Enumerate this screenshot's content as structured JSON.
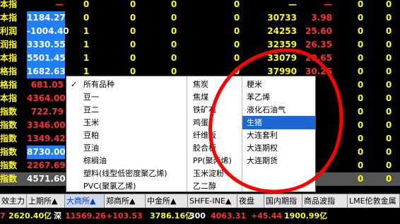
{
  "rows": [
    {
      "name": "本指",
      "price": "—",
      "c1": "0",
      "c2": "0",
      "c3": "0",
      "c4": "0",
      "vol": "—",
      "chg": "—",
      "c7": "0",
      "c8": "0",
      "hl": false,
      "pcolor": "#ff3030"
    },
    {
      "name": "本指",
      "price": "1184.27",
      "c1": "0",
      "c2": "0",
      "c3": "0",
      "c4": "0",
      "vol": "30733",
      "chg": "3.98",
      "c7": "0",
      "c8": "0",
      "hl": true,
      "pcolor": "#ffffff"
    },
    {
      "name": "利润",
      "price": "-1004.40",
      "c1": "1",
      "c2": "0",
      "c3": "0",
      "c4": "0",
      "vol": "24253",
      "chg": "25.60",
      "c7": "0",
      "c8": "0",
      "hl": true,
      "pcolor": "#ffffff"
    },
    {
      "name": "润指",
      "price": "3330.55",
      "c1": "1",
      "c2": "0",
      "c3": "0",
      "c4": "0",
      "vol": "32359",
      "chg": "26.35",
      "c7": "0",
      "c8": "0",
      "hl": true,
      "pcolor": "#ffffff"
    },
    {
      "name": "本指",
      "price": "5501.45",
      "c1": "1",
      "c2": "0",
      "c3": "0",
      "c4": "0",
      "vol": "33079",
      "chg": "29.65",
      "c7": "0",
      "c8": "0",
      "hl": true,
      "pcolor": "#ffffff"
    },
    {
      "name": "格指",
      "price": "1682.63",
      "c1": "1",
      "c2": "0",
      "c3": "0",
      "c4": "0",
      "vol": "37990",
      "chg": "30.26",
      "c7": "0",
      "c8": "0",
      "hl": true,
      "pcolor": "#ffffff"
    },
    {
      "name": "格指",
      "price": "681.05",
      "c1": "",
      "c2": "",
      "c3": "",
      "c4": "",
      "vol": "",
      "chg": "",
      "c7": "0",
      "c8": "0",
      "hl": false,
      "pcolor": "#ff3030"
    },
    {
      "name": "本指",
      "price": "4364.00",
      "c1": "",
      "c2": "",
      "c3": "",
      "c4": "",
      "vol": "",
      "chg": "",
      "c7": "0",
      "c8": "0",
      "hl": false,
      "pcolor": "#ff3030"
    },
    {
      "name": "指数",
      "price": "722.79",
      "c1": "",
      "c2": "",
      "c3": "",
      "c4": "",
      "vol": "",
      "chg": "",
      "c7": "0",
      "c8": "0",
      "hl": false,
      "pcolor": "#ff3030"
    },
    {
      "name": "指数",
      "price": "3346.00",
      "c1": "",
      "c2": "",
      "c3": "",
      "c4": "",
      "vol": "",
      "chg": "",
      "c7": "0",
      "c8": "0",
      "hl": false,
      "pcolor": "#ff3030"
    },
    {
      "name": "指数",
      "price": "1349.42",
      "c1": "",
      "c2": "",
      "c3": "",
      "c4": "",
      "vol": "",
      "chg": "",
      "c7": "0",
      "c8": "0",
      "hl": false,
      "pcolor": "#ff3030"
    },
    {
      "name": "指数",
      "price": "8730.00",
      "c1": "",
      "c2": "",
      "c3": "",
      "c4": "",
      "vol": "",
      "chg": "",
      "c7": "0",
      "c8": "0",
      "hl": true,
      "pcolor": "#ffffff"
    },
    {
      "name": "指数",
      "price": "2267.69",
      "c1": "",
      "c2": "",
      "c3": "",
      "c4": "",
      "vol": "",
      "chg": "",
      "c7": "0",
      "c8": "0",
      "hl": false,
      "pcolor": "#ff3030"
    },
    {
      "name": "指数",
      "price": "4571.60",
      "c1": "",
      "c2": "",
      "c3": "",
      "c4": "",
      "vol": "",
      "chg": "",
      "c7": "0",
      "c8": "0",
      "hl": false,
      "pcolor": "#ffffff",
      "sel": true
    }
  ],
  "menu": {
    "col1": [
      {
        "label": "所有品种",
        "checked": true
      },
      {
        "label": "豆一"
      },
      {
        "label": "豆二"
      },
      {
        "label": "玉米"
      },
      {
        "label": "豆粕"
      },
      {
        "label": "豆油"
      },
      {
        "label": "棕榈油"
      },
      {
        "label": "塑料(线型低密度聚乙烯)"
      },
      {
        "label": "PVC(聚氯乙烯)"
      }
    ],
    "col2": [
      {
        "label": "焦炭"
      },
      {
        "label": "焦煤"
      },
      {
        "label": "铁矿石"
      },
      {
        "label": "鸡蛋"
      },
      {
        "label": "纤维板"
      },
      {
        "label": "胶合板"
      },
      {
        "label": "PP(聚丙烯)"
      },
      {
        "label": "玉米淀粉"
      },
      {
        "label": "乙二醇"
      }
    ],
    "col3": [
      {
        "label": "粳米"
      },
      {
        "label": "苯乙烯"
      },
      {
        "label": "液化石油气"
      },
      {
        "label": "生猪",
        "hl": true
      },
      {
        "label": "大连套利"
      },
      {
        "label": "大连期权"
      },
      {
        "label": "大连期货"
      }
    ]
  },
  "tabs": [
    {
      "label": "效主力",
      "active": false
    },
    {
      "label": "上期所▲",
      "active": false
    },
    {
      "label": "大商所▲",
      "active": true
    },
    {
      "label": "郑商所▲",
      "active": false
    },
    {
      "label": "中金所▲",
      "active": false
    },
    {
      "label": "SHFE-INE▲",
      "active": false
    },
    {
      "label": "夜盘",
      "active": false
    },
    {
      "label": "国内期指",
      "active": false
    },
    {
      "label": "商品波指",
      "active": false
    },
    {
      "label": "LME伦敦金属",
      "active": false
    }
  ],
  "status": [
    {
      "text": "7",
      "color": "#ff3030"
    },
    {
      "text": "2620.40亿",
      "color": "#ffff00"
    },
    {
      "text": "深",
      "color": "#ffffff"
    },
    {
      "text": "11569.26",
      "color": "#ff3030"
    },
    {
      "text": "+103.53",
      "color": "#ff3030"
    },
    {
      "text": "3786.16亿",
      "color": "#ffff00"
    },
    {
      "text": "300",
      "color": "#ffffff"
    },
    {
      "text": "4063.31",
      "color": "#ff3030"
    },
    {
      "text": "+45.44",
      "color": "#ff3030"
    },
    {
      "text": "1900.99亿",
      "color": "#ffff00"
    }
  ],
  "colors": {
    "highlight": "#1e7fff",
    "menu_highlight": "#1e67d2",
    "annotation": "#ff0000",
    "up": "#ff3030",
    "label": "#ffff00"
  }
}
